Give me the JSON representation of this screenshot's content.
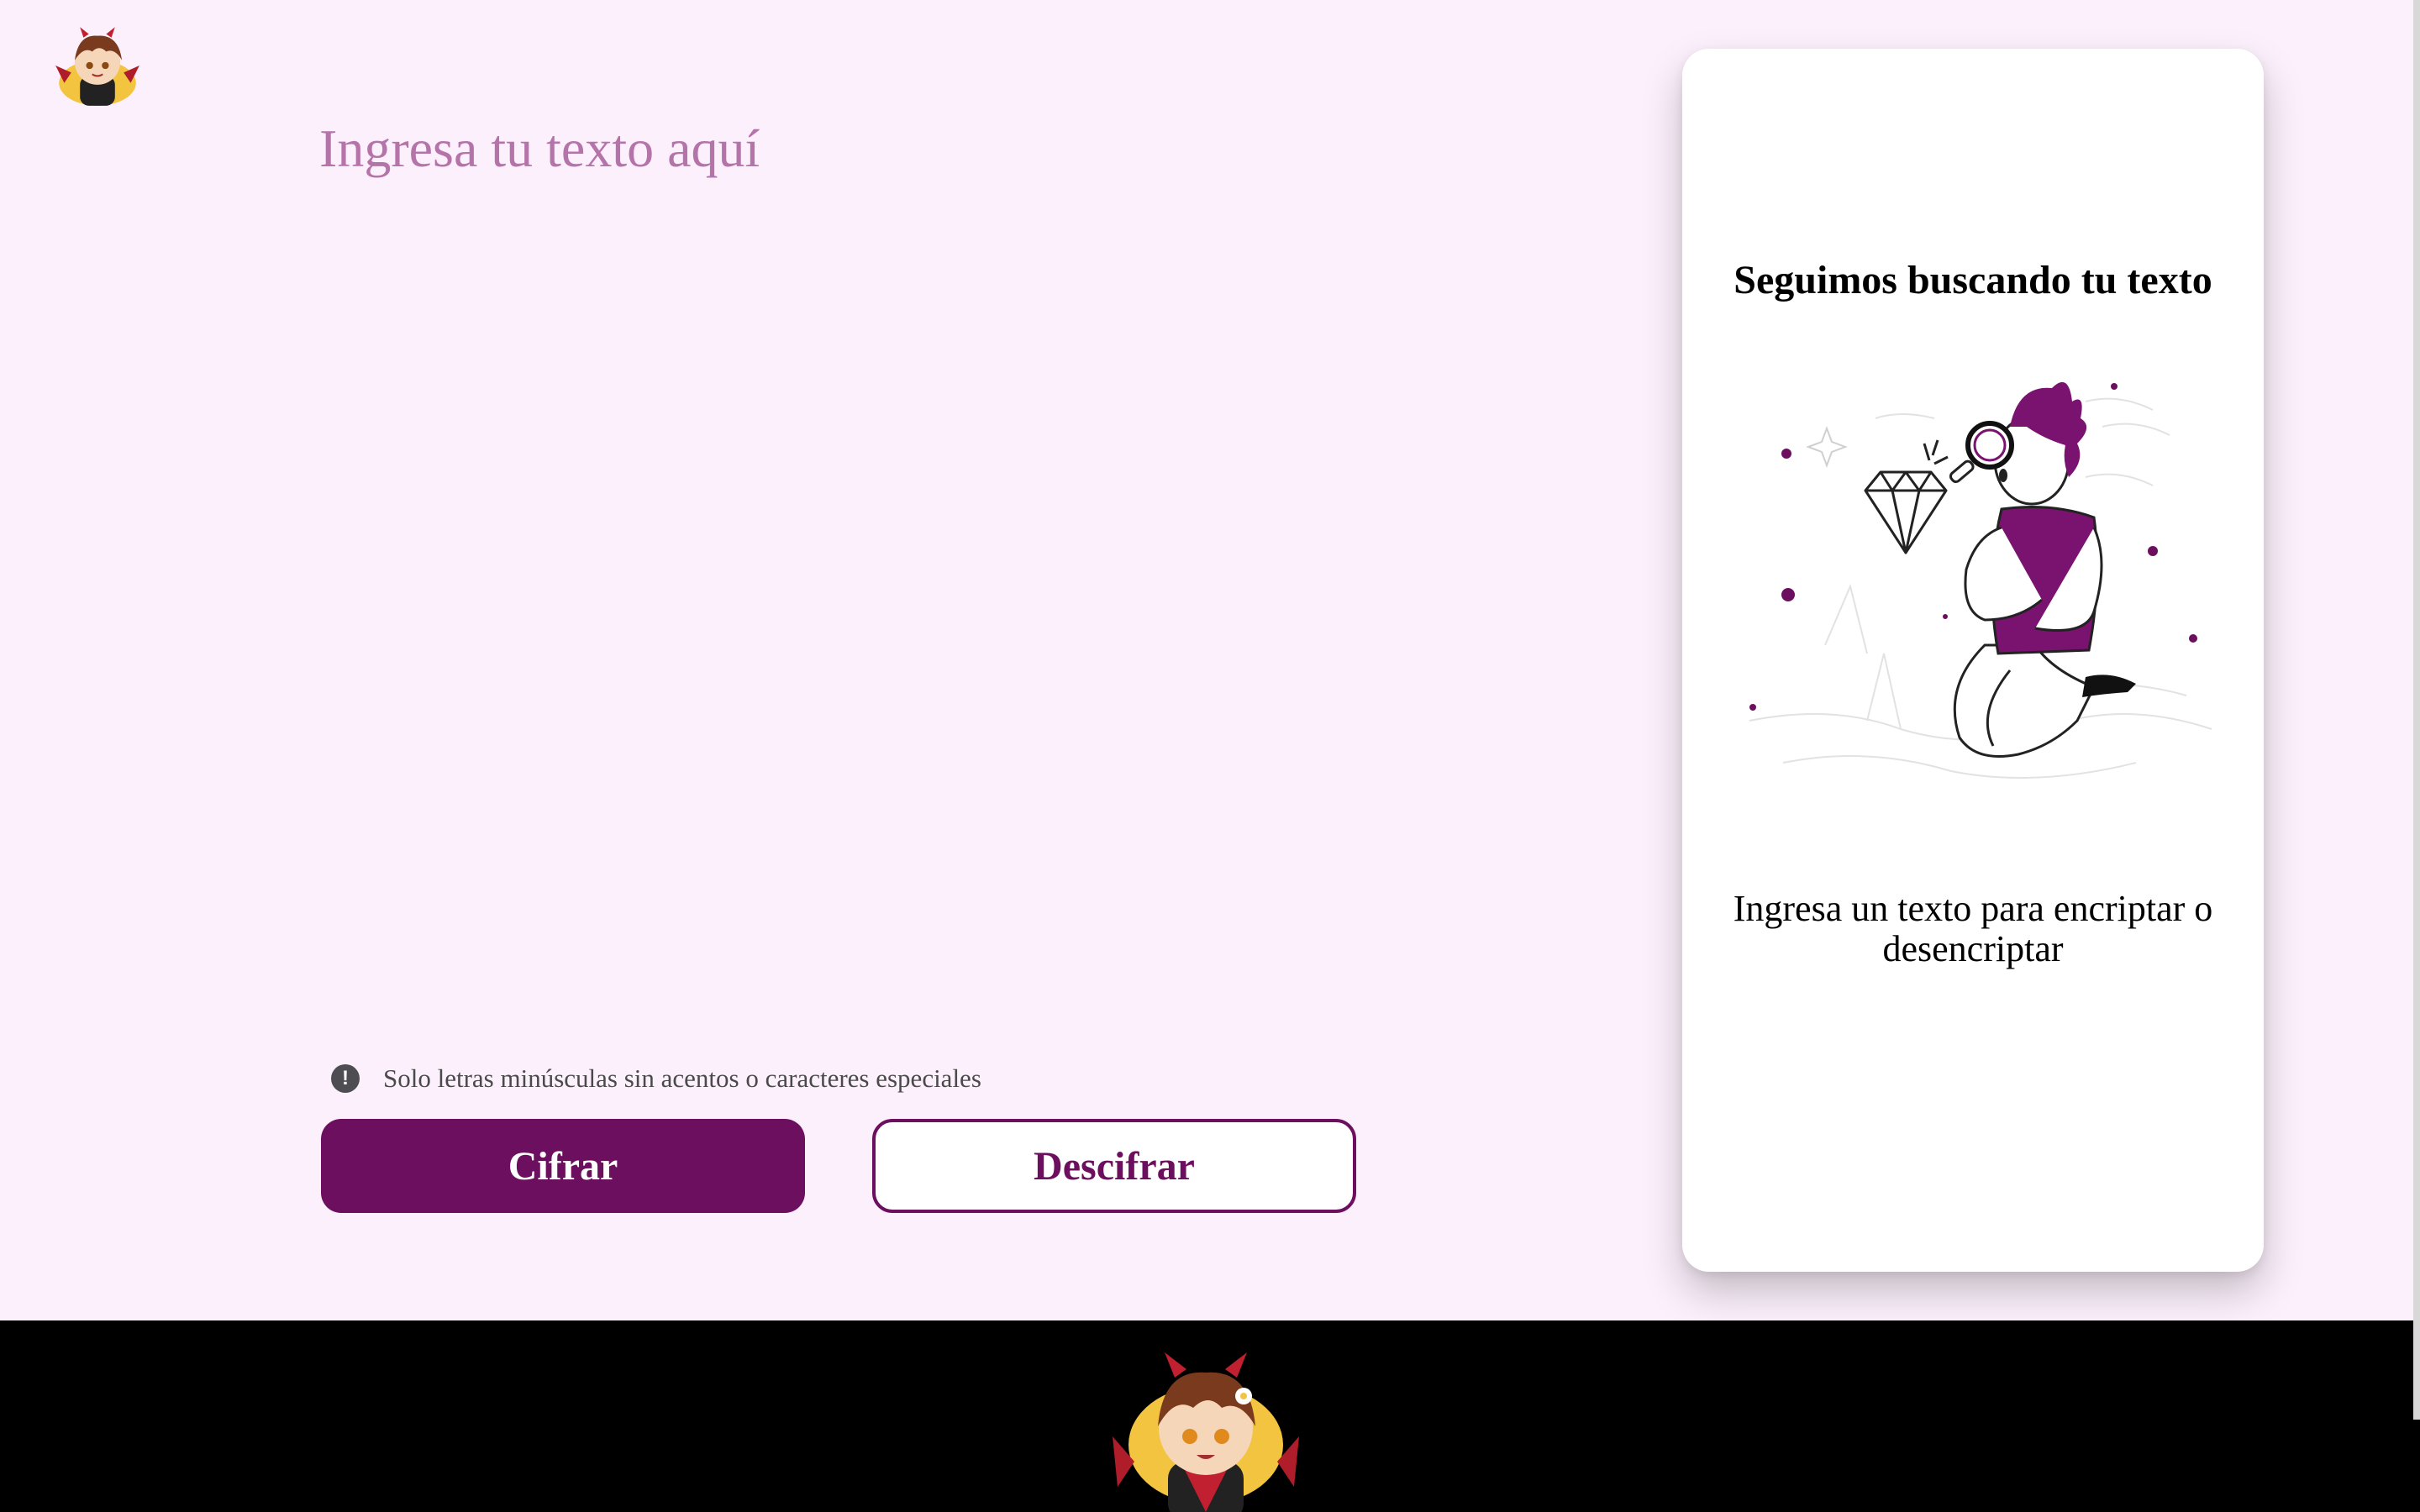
{
  "header": {
    "logo_icon": "chibi-dragon-avatar-logo"
  },
  "input": {
    "placeholder": "Ingresa tu texto aquí",
    "value": ""
  },
  "hint": {
    "icon": "exclamation-circle-icon",
    "text": "Solo letras minúsculas sin acentos o caracteres especiales"
  },
  "buttons": {
    "encrypt_label": "Cifrar",
    "decrypt_label": "Descifrar"
  },
  "output_card": {
    "title": "Seguimos buscando tu texto",
    "illustration_icon": "person-with-magnifier-illustration",
    "message": "Ingresa un texto para encriptar o desencriptar"
  },
  "footer": {
    "logo_icon": "chibi-dragon-avatar-logo"
  },
  "colors": {
    "background": "#fcf0fc",
    "accent": "#6d0f5f",
    "placeholder": "#b574a9",
    "footer": "#000000",
    "card": "#ffffff"
  }
}
